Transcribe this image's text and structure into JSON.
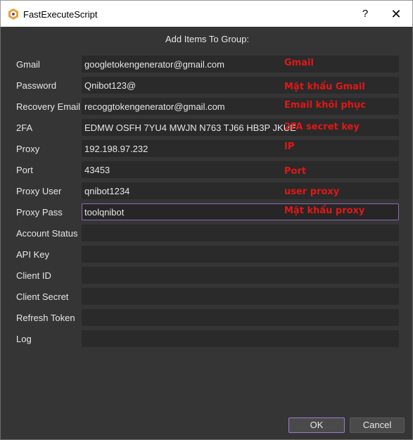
{
  "window": {
    "title": "FastExecuteScript",
    "help_label": "?",
    "close_label": "✕"
  },
  "heading": "Add Items To Group:",
  "fields": [
    {
      "label": "Gmail",
      "value": "googletokengenerator@gmail.com",
      "hint": "Gmail"
    },
    {
      "label": "Password",
      "value": "Qnibot123@",
      "hint": "Mật khẩu Gmail"
    },
    {
      "label": "Recovery Email",
      "value": "recoggtokengenerator@gmail.com",
      "hint": "Email khôi phục"
    },
    {
      "label": "2FA",
      "value": "EDMW OSFH 7YU4 MWJN N763 TJ66 HB3P JKUE",
      "hint": "2FA secret key"
    },
    {
      "label": "Proxy",
      "value": "192.198.97.232",
      "hint": "IP"
    },
    {
      "label": "Port",
      "value": "43453",
      "hint": "Port"
    },
    {
      "label": "Proxy User",
      "value": "qnibot1234",
      "hint": "user proxy"
    },
    {
      "label": "Proxy Pass",
      "value": "toolqnibot",
      "hint": "Mật khẩu proxy"
    },
    {
      "label": "Account Status",
      "value": ""
    },
    {
      "label": "API Key",
      "value": ""
    },
    {
      "label": "Client ID",
      "value": ""
    },
    {
      "label": "Client Secret",
      "value": ""
    },
    {
      "label": "Refresh Token",
      "value": ""
    },
    {
      "label": "Log",
      "value": ""
    }
  ],
  "buttons": {
    "ok": "OK",
    "cancel": "Cancel"
  },
  "colors": {
    "background": "#353535",
    "field": "#2a2a2a",
    "accent": "#a07ad0",
    "hint": "#e01818"
  },
  "icons": {
    "app": "app-logo-icon"
  }
}
